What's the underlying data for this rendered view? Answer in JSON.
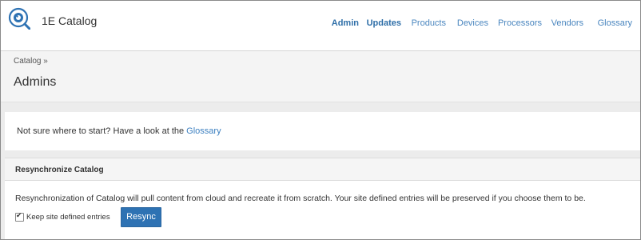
{
  "app": {
    "brand": "1E Catalog",
    "logo_icon": "magnifier-eye-icon",
    "accent_color": "#2e72b3"
  },
  "nav": {
    "items": [
      {
        "label": "Admin",
        "active": true
      },
      {
        "label": "Updates",
        "active": true
      },
      {
        "label": "Products",
        "active": false
      },
      {
        "label": "Devices",
        "active": false
      },
      {
        "label": "Processors",
        "active": false
      },
      {
        "label": "Vendors",
        "active": false
      },
      {
        "label": "Glossary",
        "active": false
      }
    ]
  },
  "breadcrumb": {
    "root": "Catalog",
    "separator": "»"
  },
  "page": {
    "title": "Admins"
  },
  "info": {
    "prefix": "Not sure where to start? Have a look at the ",
    "link": "Glossary"
  },
  "resync": {
    "heading": "Resynchronize Catalog",
    "description": "Resynchronization of Catalog will pull content from cloud and recreate it from scratch. Your site defined entries will be preserved if you choose them to be.",
    "checkbox_label": "Keep site defined entries",
    "checkbox_checked": true,
    "button_label": "Resync"
  }
}
